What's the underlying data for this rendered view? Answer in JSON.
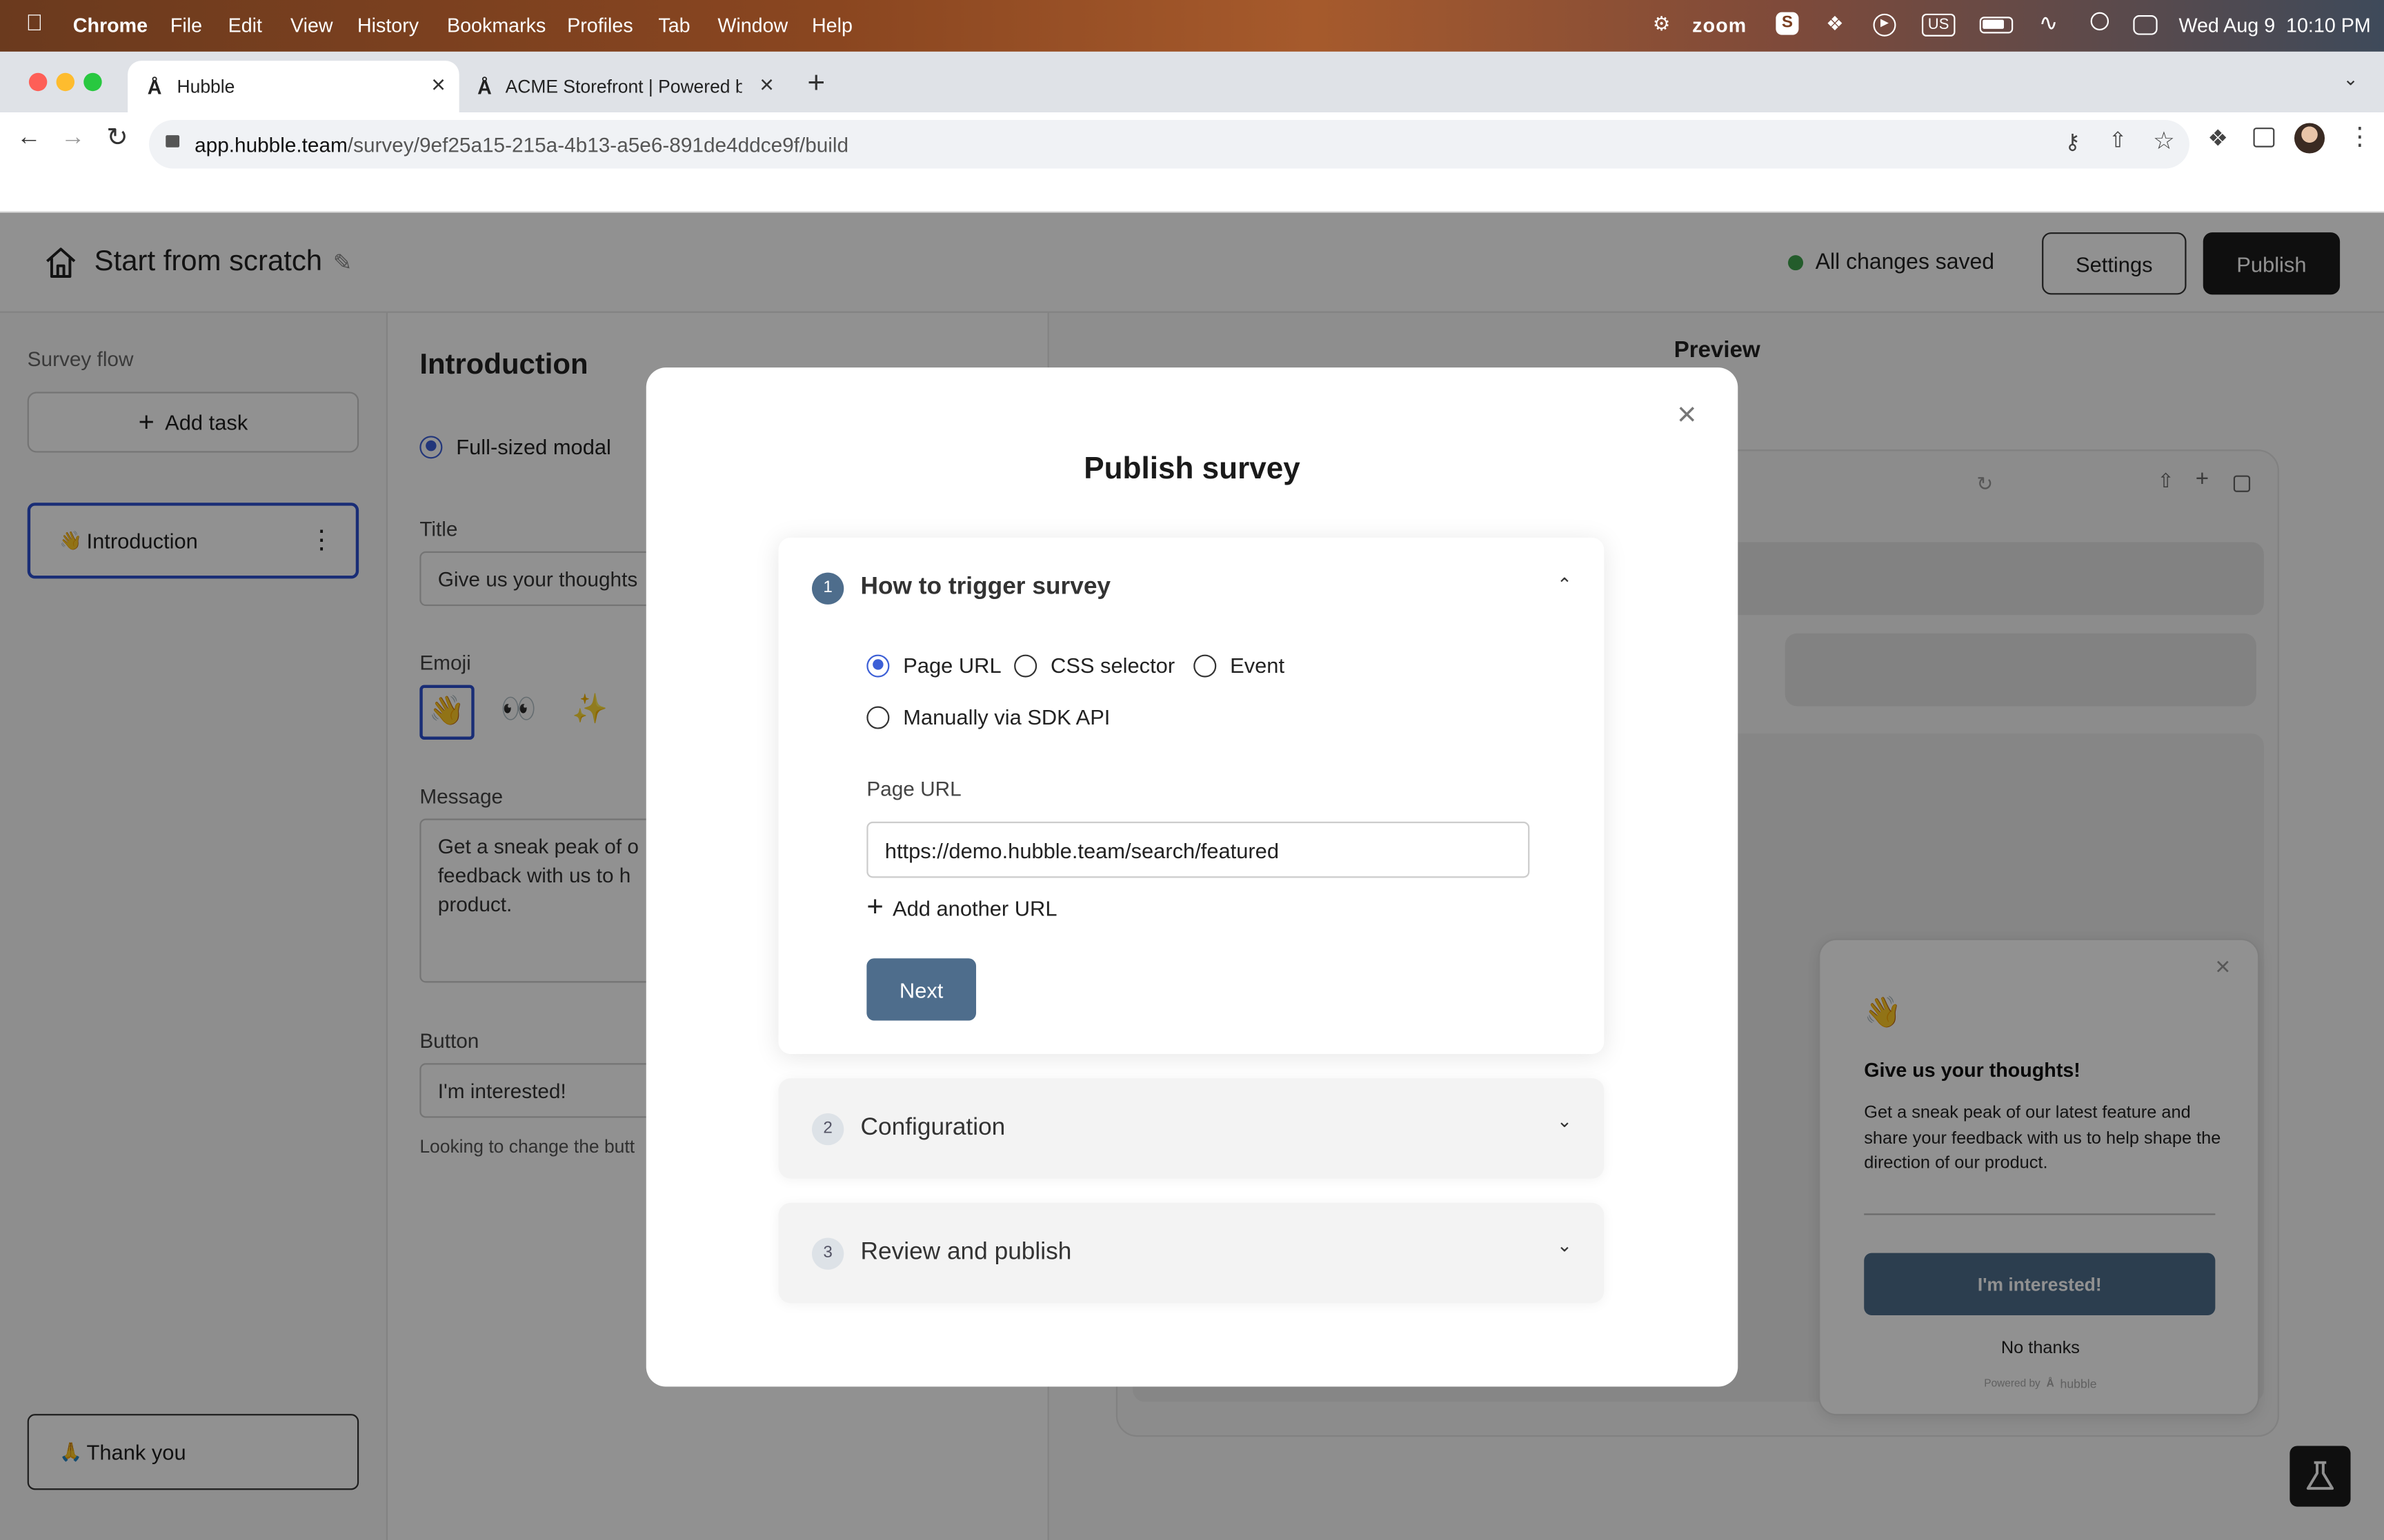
{
  "menubar": {
    "app": "Chrome",
    "items": [
      "File",
      "Edit",
      "View",
      "History",
      "Bookmarks",
      "Profiles",
      "Tab",
      "Window",
      "Help"
    ],
    "zoom": "zoom",
    "keyboard": "US",
    "datetime": "Wed Aug 9  10:10 PM"
  },
  "browser": {
    "tabs": [
      {
        "title": "Hubble",
        "active": true
      },
      {
        "title": "ACME Storefront | Powered by",
        "active": false
      }
    ],
    "url_host": "app.hubble.team",
    "url_path": "/survey/9ef25a15-215a-4b13-a5e6-891de4ddce9f/build"
  },
  "header": {
    "title": "Start from scratch",
    "status": "All changes saved",
    "status_color": "#3fa34d",
    "settings": "Settings",
    "publish": "Publish"
  },
  "sidebar": {
    "heading": "Survey flow",
    "add_task": "Add task",
    "items": [
      {
        "emoji": "👋",
        "label": "Introduction"
      },
      {
        "emoji": "🙏",
        "label": "Thank you"
      }
    ]
  },
  "editor": {
    "heading": "Introduction",
    "layout_option": "Full-sized modal",
    "title_label": "Title",
    "title_value": "Give us your thoughts",
    "emoji_label": "Emoji",
    "emojis": [
      "👋",
      "👀",
      "✨"
    ],
    "message_label": "Message",
    "message_lines": [
      "Get a sneak peak of o",
      "feedback with us to h",
      "product."
    ],
    "button_label": "Button",
    "button_value": "I'm interested!",
    "hint": "Looking to change the butt"
  },
  "preview": {
    "heading": "Preview",
    "widget": {
      "emoji": "👋",
      "title": "Give us your thoughts!",
      "message": "Get a sneak peak of our latest feature and share your feedback with us to help shape the direction of our product.",
      "cta": "I'm interested!",
      "dismiss": "No thanks",
      "powered_by": "Powered by",
      "brand": "hubble"
    }
  },
  "modal": {
    "title": "Publish survey",
    "steps": [
      {
        "number": "1",
        "title": "How to trigger survey",
        "expanded": true
      },
      {
        "number": "2",
        "title": "Configuration",
        "expanded": false
      },
      {
        "number": "3",
        "title": "Review and publish",
        "expanded": false
      }
    ],
    "trigger_options": [
      {
        "label": "Page URL",
        "selected": true
      },
      {
        "label": "CSS selector",
        "selected": false
      },
      {
        "label": "Event",
        "selected": false
      },
      {
        "label": "Manually via SDK API",
        "selected": false
      }
    ],
    "page_url_label": "Page URL",
    "page_url_value": "https://demo.hubble.team/search/featured",
    "add_url": "Add another URL",
    "next": "Next"
  },
  "colors": {
    "accent": "#4e6d8c",
    "radio": "#3c5fd6",
    "selection": "#2c4fd0"
  }
}
